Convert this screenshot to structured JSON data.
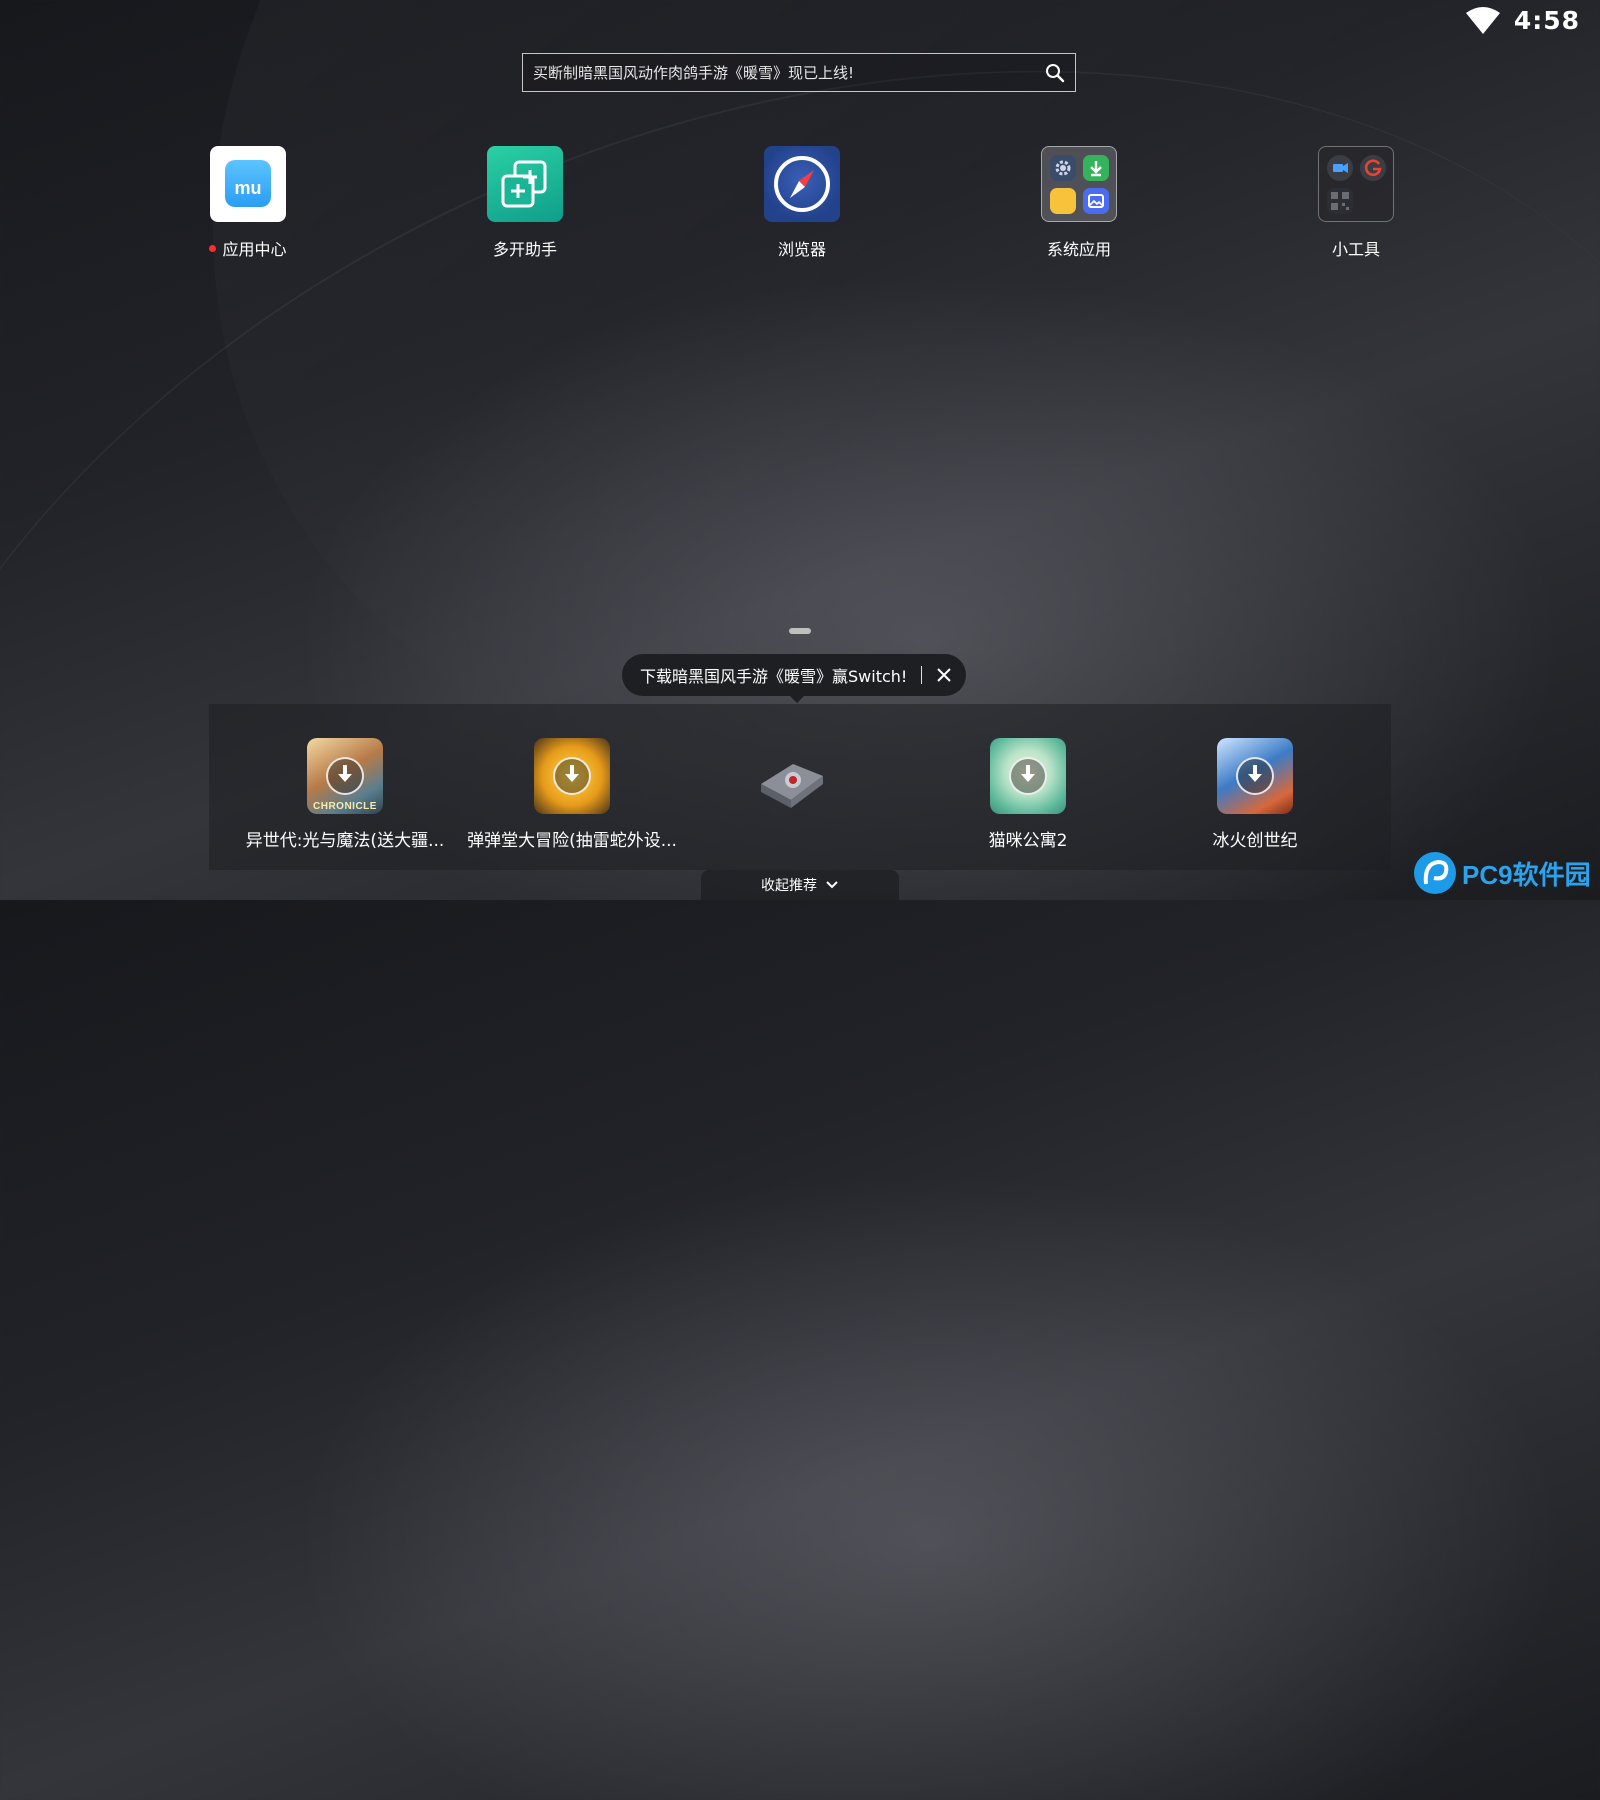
{
  "status_bar": {
    "time": "4:58",
    "wifi_icon": "wifi-icon"
  },
  "search": {
    "text": "买断制暗黑国风动作肉鸽手游《暖雪》现已上线!",
    "icon": "search-icon"
  },
  "desktop": {
    "apps": [
      {
        "label": "应用中心",
        "has_badge": true,
        "icon": "app-center-icon",
        "tile_text": "mu"
      },
      {
        "label": "多开助手",
        "icon": "multi-open-icon"
      },
      {
        "label": "浏览器",
        "icon": "compass-icon"
      },
      {
        "label": "系统应用",
        "icon": "folder-icon"
      },
      {
        "label": "小工具",
        "icon": "folder-icon"
      }
    ]
  },
  "tooltip": {
    "text": "下载暗黑国风手游《暖雪》赢Switch!",
    "close_icon": "close-icon"
  },
  "recommendations": {
    "items": [
      {
        "name": "异世代:光与魔法(送大疆...",
        "image_text": "CHRONICLE",
        "download": true
      },
      {
        "name": "弹弹堂大冒险(抽雷蛇外设...",
        "download": true
      },
      {
        "name": "",
        "download": false
      },
      {
        "name": "猫咪公寓2",
        "download": true
      },
      {
        "name": "冰火创世纪",
        "download": true
      }
    ],
    "collapse_label": "收起推荐",
    "collapse_icon": "chevron-down-icon"
  },
  "watermark": {
    "text": "PC9软件园"
  },
  "colors": {
    "badge": "#ff2d2d",
    "accent": "#1e9be8"
  }
}
